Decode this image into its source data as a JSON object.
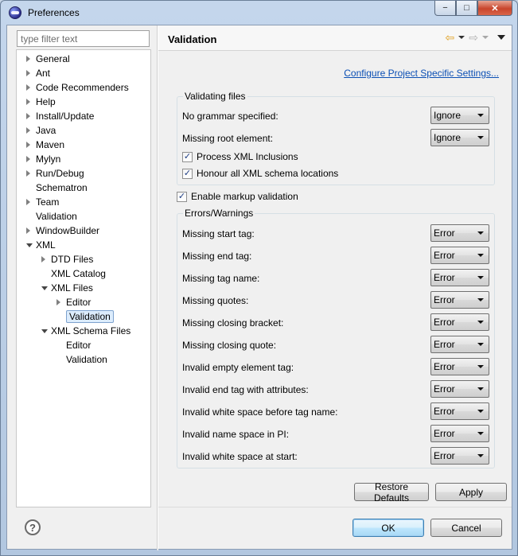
{
  "window": {
    "title": "Preferences",
    "minimize_glyph": "−",
    "maximize_glyph": "□",
    "close_glyph": "✕"
  },
  "filter": {
    "placeholder": "type filter text"
  },
  "tree": [
    {
      "label": "General",
      "twisty": "closed"
    },
    {
      "label": "Ant",
      "twisty": "closed"
    },
    {
      "label": "Code Recommenders",
      "twisty": "closed"
    },
    {
      "label": "Help",
      "twisty": "closed"
    },
    {
      "label": "Install/Update",
      "twisty": "closed"
    },
    {
      "label": "Java",
      "twisty": "closed"
    },
    {
      "label": "Maven",
      "twisty": "closed"
    },
    {
      "label": "Mylyn",
      "twisty": "closed"
    },
    {
      "label": "Run/Debug",
      "twisty": "closed"
    },
    {
      "label": "Schematron",
      "twisty": "none"
    },
    {
      "label": "Team",
      "twisty": "closed"
    },
    {
      "label": "Validation",
      "twisty": "none"
    },
    {
      "label": "WindowBuilder",
      "twisty": "closed"
    },
    {
      "label": "XML",
      "twisty": "open"
    },
    {
      "label": "DTD Files",
      "twisty": "closed"
    },
    {
      "label": "XML Catalog",
      "twisty": "none"
    },
    {
      "label": "XML Files",
      "twisty": "open"
    },
    {
      "label": "Editor",
      "twisty": "closed"
    },
    {
      "label": "Validation",
      "twisty": "none",
      "selected": true
    },
    {
      "label": "XML Schema Files",
      "twisty": "open"
    },
    {
      "label": "Editor",
      "twisty": "none"
    },
    {
      "label": "Validation",
      "twisty": "none"
    }
  ],
  "page": {
    "title": "Validation",
    "configure_link": "Configure Project Specific Settings..."
  },
  "validating_files": {
    "title": "Validating files",
    "no_grammar": {
      "label": "No grammar specified:",
      "value": "Ignore"
    },
    "missing_root": {
      "label": "Missing root element:",
      "value": "Ignore"
    },
    "process_inclusions": {
      "label": "Process XML Inclusions",
      "checked": true
    },
    "honour_schema": {
      "label": "Honour all XML schema locations",
      "checked": true
    }
  },
  "enable_markup": {
    "label": "Enable markup validation",
    "checked": true
  },
  "errors_warnings": {
    "title": "Errors/Warnings",
    "rows": [
      {
        "label": "Missing start tag:",
        "value": "Error"
      },
      {
        "label": "Missing end tag:",
        "value": "Error"
      },
      {
        "label": "Missing tag name:",
        "value": "Error"
      },
      {
        "label": "Missing quotes:",
        "value": "Error"
      },
      {
        "label": "Missing closing bracket:",
        "value": "Error"
      },
      {
        "label": "Missing closing quote:",
        "value": "Error"
      },
      {
        "label": "Invalid empty element tag:",
        "value": "Error"
      },
      {
        "label": "Invalid end tag with attributes:",
        "value": "Error"
      },
      {
        "label": "Invalid white space before tag name:",
        "value": "Error"
      },
      {
        "label": "Invalid name space in PI:",
        "value": "Error"
      },
      {
        "label": "Invalid white space at start:",
        "value": "Error"
      }
    ]
  },
  "buttons": {
    "restore_defaults": "Restore Defaults",
    "apply": "Apply",
    "ok": "OK",
    "cancel": "Cancel",
    "help": "?"
  },
  "icons": {
    "app": "eclipse-icon",
    "back": "back-arrow-icon",
    "forward": "forward-arrow-icon",
    "view_menu": "view-menu-icon",
    "help": "help-icon",
    "check": "✓"
  }
}
